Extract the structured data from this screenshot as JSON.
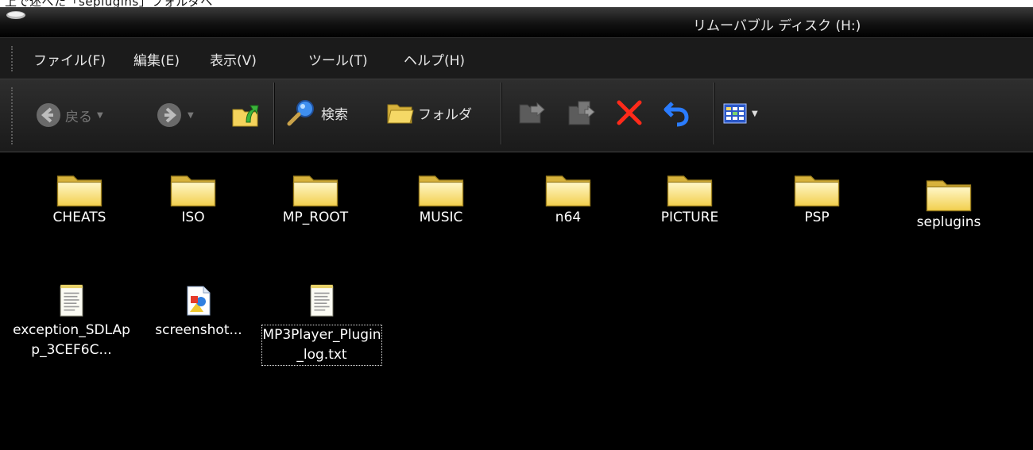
{
  "window": {
    "title": "リムーバブル ディスク (H:)"
  },
  "top_strip_text": "上で述べた「seplugins」フォルダへ",
  "menu": [
    {
      "label": "ファイル(F)"
    },
    {
      "label": "編集(E)"
    },
    {
      "label": "表示(V)"
    },
    {
      "label": "ツール(T)"
    },
    {
      "label": "ヘルプ(H)"
    }
  ],
  "toolbar": {
    "back_label": "戻る",
    "search_label": "検索",
    "folders_label": "フォルダ"
  },
  "files": [
    {
      "name": "CHEATS",
      "type": "folder"
    },
    {
      "name": "ISO",
      "type": "folder"
    },
    {
      "name": "MP_ROOT",
      "type": "folder"
    },
    {
      "name": "MUSIC",
      "type": "folder"
    },
    {
      "name": "n64",
      "type": "folder"
    },
    {
      "name": "PICTURE",
      "type": "folder"
    },
    {
      "name": "PSP",
      "type": "folder"
    },
    {
      "name": "seplugins",
      "type": "folder"
    },
    {
      "name": "exception_SDLApp_3CEF6C...",
      "type": "text-file"
    },
    {
      "name": "screenshot...",
      "type": "image-file"
    },
    {
      "name": "MP3Player_Plugin_log.txt",
      "type": "text-file",
      "focused": true
    }
  ],
  "colors": {
    "folder": "#f5d866",
    "delete": "#ff2a1a",
    "undo": "#2a7cff",
    "content_bg": "#000000"
  }
}
